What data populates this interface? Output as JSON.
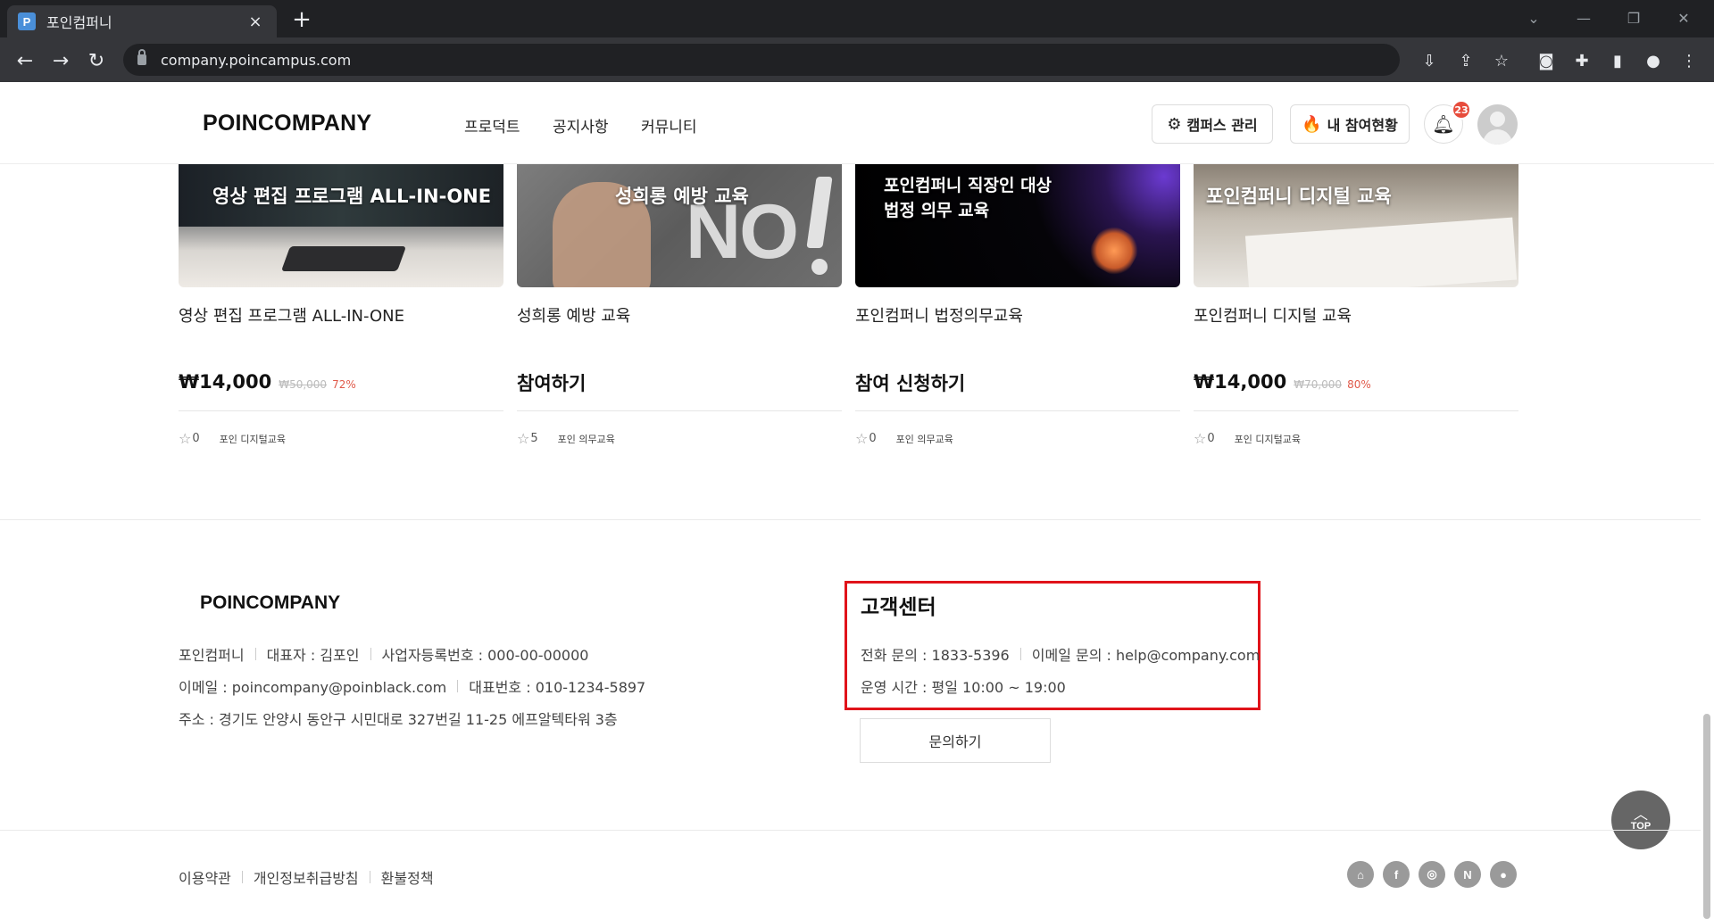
{
  "browser": {
    "tab_title": "포인컴퍼니",
    "favicon": "P",
    "url": "company.poincampus.com",
    "new_tab": "+",
    "close": "×"
  },
  "header": {
    "logo": "POINCOMPANY",
    "nav": [
      "프로덕트",
      "공지사항",
      "커뮤니티"
    ],
    "campus_btn": "캠퍼스 관리",
    "participation_btn": "내 참여현황",
    "notification_count": "23"
  },
  "cards": [
    {
      "thumb_text": "영상 편집 프로그램 ALL-IN-ONE",
      "title": "영상 편집 프로그램 ALL-IN-ONE",
      "price": "₩14,000",
      "original_price": "₩50,000",
      "discount": "72%",
      "rating": "0",
      "tag": "포인 디지털교육"
    },
    {
      "thumb_text": "성희롱 예방 교육",
      "thumb_big": "NO",
      "title": "성희롱 예방 교육",
      "cta": "참여하기",
      "rating": "5",
      "tag": "포인 의무교육"
    },
    {
      "thumb_text_line1": "포인컴퍼니 직장인 대상",
      "thumb_text_line2": "법정 의무 교육",
      "title": "포인컴퍼니 법정의무교육",
      "cta": "참여 신청하기",
      "rating": "0",
      "tag": "포인 의무교육"
    },
    {
      "thumb_text": "포인컴퍼니 디지털 교육",
      "title": "포인컴퍼니 디지털 교육",
      "price": "₩14,000",
      "original_price": "₩70,000",
      "discount": "80%",
      "rating": "0",
      "tag": "포인 디지털교육"
    }
  ],
  "footer": {
    "logo": "POINCOMPANY",
    "company_name": "포인컴퍼니",
    "ceo": "대표자 : 김포인",
    "biz_no": "사업자등록번호 : 000-00-00000",
    "email": "이메일 : poincompany@poinblack.com",
    "phone": "대표번호 : 010-1234-5897",
    "address": "주소 : 경기도 안양시 동안구 시민대로 327번길 11-25 에프알텍타워 3층",
    "cs_title": "고객센터",
    "cs_phone": "전화 문의 : 1833-5396",
    "cs_email": "이메일 문의 : help@company.com",
    "cs_hours": "운영 시간 : 평일 10:00 ~ 19:00",
    "inquiry_btn": "문의하기",
    "top_btn": "TOP",
    "policies": [
      "이용약관",
      "개인정보취급방침",
      "환불정책"
    ],
    "social": [
      "home-icon",
      "facebook-icon",
      "instagram-icon",
      "naver-icon",
      "chat-icon"
    ]
  },
  "colors": {
    "highlight_border": "#e0131a",
    "discount": "#e05a4a",
    "badge": "#e74c3c"
  }
}
